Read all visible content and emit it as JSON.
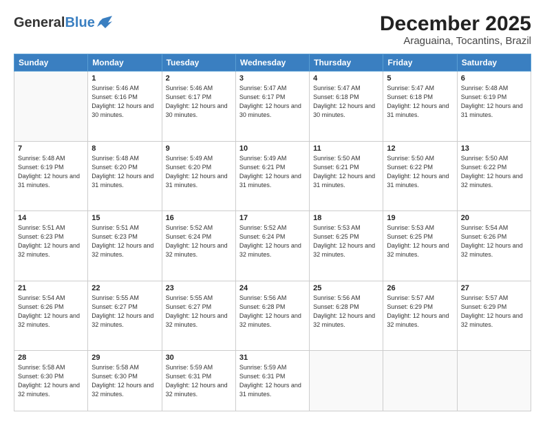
{
  "header": {
    "logo_general": "General",
    "logo_blue": "Blue",
    "title": "December 2025",
    "subtitle": "Araguaina, Tocantins, Brazil"
  },
  "weekdays": [
    "Sunday",
    "Monday",
    "Tuesday",
    "Wednesday",
    "Thursday",
    "Friday",
    "Saturday"
  ],
  "rows": [
    [
      {
        "day": "",
        "sunrise": "",
        "sunset": "",
        "daylight": ""
      },
      {
        "day": "1",
        "sunrise": "Sunrise: 5:46 AM",
        "sunset": "Sunset: 6:16 PM",
        "daylight": "Daylight: 12 hours and 30 minutes."
      },
      {
        "day": "2",
        "sunrise": "Sunrise: 5:46 AM",
        "sunset": "Sunset: 6:17 PM",
        "daylight": "Daylight: 12 hours and 30 minutes."
      },
      {
        "day": "3",
        "sunrise": "Sunrise: 5:47 AM",
        "sunset": "Sunset: 6:17 PM",
        "daylight": "Daylight: 12 hours and 30 minutes."
      },
      {
        "day": "4",
        "sunrise": "Sunrise: 5:47 AM",
        "sunset": "Sunset: 6:18 PM",
        "daylight": "Daylight: 12 hours and 30 minutes."
      },
      {
        "day": "5",
        "sunrise": "Sunrise: 5:47 AM",
        "sunset": "Sunset: 6:18 PM",
        "daylight": "Daylight: 12 hours and 31 minutes."
      },
      {
        "day": "6",
        "sunrise": "Sunrise: 5:48 AM",
        "sunset": "Sunset: 6:19 PM",
        "daylight": "Daylight: 12 hours and 31 minutes."
      }
    ],
    [
      {
        "day": "7",
        "sunrise": "Sunrise: 5:48 AM",
        "sunset": "Sunset: 6:19 PM",
        "daylight": "Daylight: 12 hours and 31 minutes."
      },
      {
        "day": "8",
        "sunrise": "Sunrise: 5:48 AM",
        "sunset": "Sunset: 6:20 PM",
        "daylight": "Daylight: 12 hours and 31 minutes."
      },
      {
        "day": "9",
        "sunrise": "Sunrise: 5:49 AM",
        "sunset": "Sunset: 6:20 PM",
        "daylight": "Daylight: 12 hours and 31 minutes."
      },
      {
        "day": "10",
        "sunrise": "Sunrise: 5:49 AM",
        "sunset": "Sunset: 6:21 PM",
        "daylight": "Daylight: 12 hours and 31 minutes."
      },
      {
        "day": "11",
        "sunrise": "Sunrise: 5:50 AM",
        "sunset": "Sunset: 6:21 PM",
        "daylight": "Daylight: 12 hours and 31 minutes."
      },
      {
        "day": "12",
        "sunrise": "Sunrise: 5:50 AM",
        "sunset": "Sunset: 6:22 PM",
        "daylight": "Daylight: 12 hours and 31 minutes."
      },
      {
        "day": "13",
        "sunrise": "Sunrise: 5:50 AM",
        "sunset": "Sunset: 6:22 PM",
        "daylight": "Daylight: 12 hours and 32 minutes."
      }
    ],
    [
      {
        "day": "14",
        "sunrise": "Sunrise: 5:51 AM",
        "sunset": "Sunset: 6:23 PM",
        "daylight": "Daylight: 12 hours and 32 minutes."
      },
      {
        "day": "15",
        "sunrise": "Sunrise: 5:51 AM",
        "sunset": "Sunset: 6:23 PM",
        "daylight": "Daylight: 12 hours and 32 minutes."
      },
      {
        "day": "16",
        "sunrise": "Sunrise: 5:52 AM",
        "sunset": "Sunset: 6:24 PM",
        "daylight": "Daylight: 12 hours and 32 minutes."
      },
      {
        "day": "17",
        "sunrise": "Sunrise: 5:52 AM",
        "sunset": "Sunset: 6:24 PM",
        "daylight": "Daylight: 12 hours and 32 minutes."
      },
      {
        "day": "18",
        "sunrise": "Sunrise: 5:53 AM",
        "sunset": "Sunset: 6:25 PM",
        "daylight": "Daylight: 12 hours and 32 minutes."
      },
      {
        "day": "19",
        "sunrise": "Sunrise: 5:53 AM",
        "sunset": "Sunset: 6:25 PM",
        "daylight": "Daylight: 12 hours and 32 minutes."
      },
      {
        "day": "20",
        "sunrise": "Sunrise: 5:54 AM",
        "sunset": "Sunset: 6:26 PM",
        "daylight": "Daylight: 12 hours and 32 minutes."
      }
    ],
    [
      {
        "day": "21",
        "sunrise": "Sunrise: 5:54 AM",
        "sunset": "Sunset: 6:26 PM",
        "daylight": "Daylight: 12 hours and 32 minutes."
      },
      {
        "day": "22",
        "sunrise": "Sunrise: 5:55 AM",
        "sunset": "Sunset: 6:27 PM",
        "daylight": "Daylight: 12 hours and 32 minutes."
      },
      {
        "day": "23",
        "sunrise": "Sunrise: 5:55 AM",
        "sunset": "Sunset: 6:27 PM",
        "daylight": "Daylight: 12 hours and 32 minutes."
      },
      {
        "day": "24",
        "sunrise": "Sunrise: 5:56 AM",
        "sunset": "Sunset: 6:28 PM",
        "daylight": "Daylight: 12 hours and 32 minutes."
      },
      {
        "day": "25",
        "sunrise": "Sunrise: 5:56 AM",
        "sunset": "Sunset: 6:28 PM",
        "daylight": "Daylight: 12 hours and 32 minutes."
      },
      {
        "day": "26",
        "sunrise": "Sunrise: 5:57 AM",
        "sunset": "Sunset: 6:29 PM",
        "daylight": "Daylight: 12 hours and 32 minutes."
      },
      {
        "day": "27",
        "sunrise": "Sunrise: 5:57 AM",
        "sunset": "Sunset: 6:29 PM",
        "daylight": "Daylight: 12 hours and 32 minutes."
      }
    ],
    [
      {
        "day": "28",
        "sunrise": "Sunrise: 5:58 AM",
        "sunset": "Sunset: 6:30 PM",
        "daylight": "Daylight: 12 hours and 32 minutes."
      },
      {
        "day": "29",
        "sunrise": "Sunrise: 5:58 AM",
        "sunset": "Sunset: 6:30 PM",
        "daylight": "Daylight: 12 hours and 32 minutes."
      },
      {
        "day": "30",
        "sunrise": "Sunrise: 5:59 AM",
        "sunset": "Sunset: 6:31 PM",
        "daylight": "Daylight: 12 hours and 32 minutes."
      },
      {
        "day": "31",
        "sunrise": "Sunrise: 5:59 AM",
        "sunset": "Sunset: 6:31 PM",
        "daylight": "Daylight: 12 hours and 31 minutes."
      },
      {
        "day": "",
        "sunrise": "",
        "sunset": "",
        "daylight": ""
      },
      {
        "day": "",
        "sunrise": "",
        "sunset": "",
        "daylight": ""
      },
      {
        "day": "",
        "sunrise": "",
        "sunset": "",
        "daylight": ""
      }
    ]
  ]
}
